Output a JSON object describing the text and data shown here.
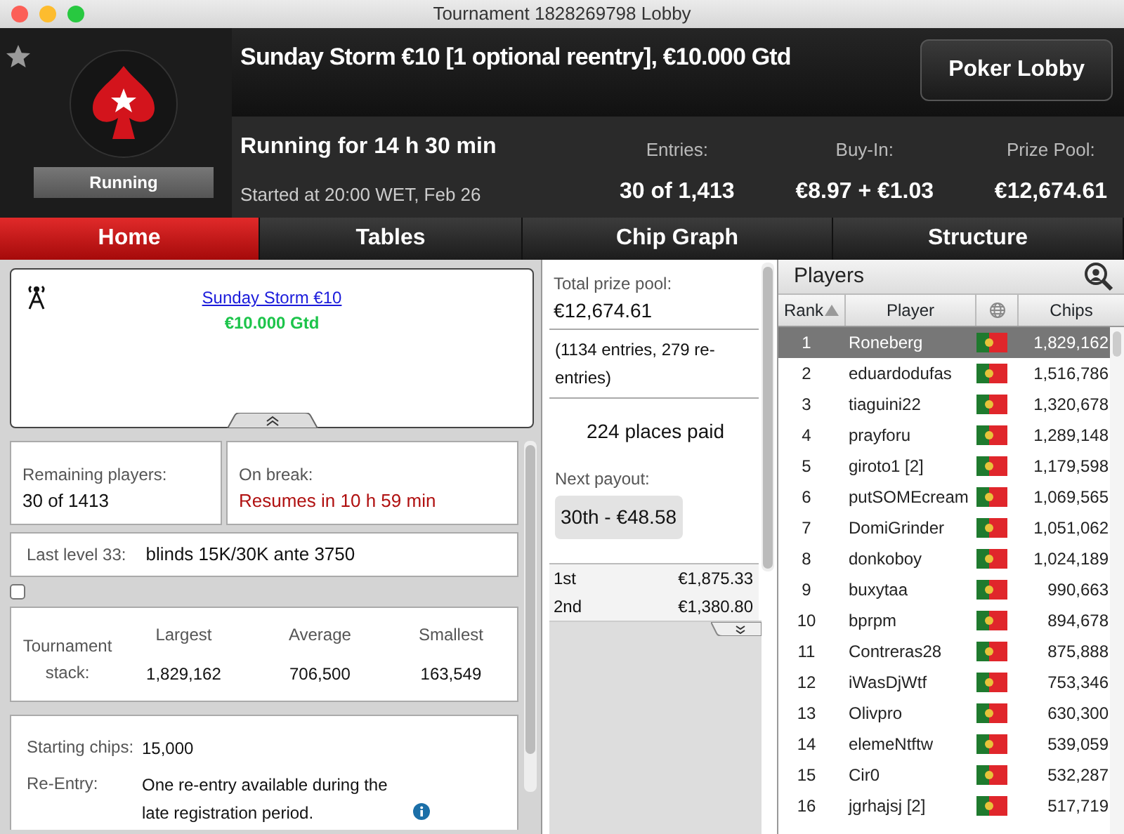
{
  "window": {
    "title": "Tournament 1828269798 Lobby"
  },
  "header": {
    "favorite": false,
    "status": "Running",
    "title": "Sunday Storm €10 [1 optional reentry], €10.000 Gtd",
    "running_for": "Running for 14 h 30 min",
    "started": "Started at 20:00 WET, Feb 26",
    "button": "Poker Lobby",
    "stats": [
      {
        "label": "Entries:",
        "value": "30 of 1,413"
      },
      {
        "label": "Buy-In:",
        "value": "€8.97 + €1.03"
      },
      {
        "label": "Prize Pool:",
        "value": "€12,674.61"
      }
    ]
  },
  "tabs": [
    {
      "label": "Home",
      "selected": true
    },
    {
      "label": "Tables",
      "selected": false
    },
    {
      "label": "Chip Graph",
      "selected": false
    },
    {
      "label": "Structure",
      "selected": false
    }
  ],
  "info": {
    "link": "Sunday Storm €10",
    "guarantee": "€10.000 Gtd"
  },
  "remaining": {
    "label": "Remaining players:",
    "value": "30 of 1413"
  },
  "break": {
    "label": "On break:",
    "value": "Resumes in 10 h 59 min"
  },
  "level": {
    "label": "Last level 33:",
    "value": "blinds 15K/30K ante 3750"
  },
  "option_checkbox": {
    "checked": false
  },
  "stack": {
    "label": "Tournament stack:",
    "columns": [
      {
        "label": "Largest",
        "value": "1,829,162"
      },
      {
        "label": "Average",
        "value": "706,500"
      },
      {
        "label": "Smallest",
        "value": "163,549"
      }
    ]
  },
  "details": [
    {
      "label": "Starting chips:",
      "value": "15,000",
      "info": false
    },
    {
      "label": "Re-Entry:",
      "value": "One re-entry available during the late registration period.",
      "info": true
    }
  ],
  "prizes": {
    "total_label": "Total prize pool:",
    "total": "€12,674.61",
    "entries": "(1134 entries, 279 re-entries)",
    "places": "224 places paid",
    "next_label": "Next payout:",
    "next": "30th - €48.58",
    "payouts": [
      {
        "place": "1st",
        "amount": "€1,875.33"
      },
      {
        "place": "2nd",
        "amount": "€1,380.80"
      }
    ]
  },
  "players": {
    "title": "Players",
    "columns": [
      "Rank",
      "Player",
      "Chips"
    ],
    "rows": [
      {
        "rank": "1",
        "name": "Roneberg",
        "chips": "1,829,162",
        "selected": true
      },
      {
        "rank": "2",
        "name": "eduardodufas",
        "chips": "1,516,786",
        "selected": false
      },
      {
        "rank": "3",
        "name": "tiaguini22",
        "chips": "1,320,678",
        "selected": false
      },
      {
        "rank": "4",
        "name": "prayforu",
        "chips": "1,289,148",
        "selected": false
      },
      {
        "rank": "5",
        "name": "giroto1 [2]",
        "chips": "1,179,598",
        "selected": false
      },
      {
        "rank": "6",
        "name": "putSOMEcream",
        "chips": "1,069,565",
        "selected": false
      },
      {
        "rank": "7",
        "name": "DomiGrinder",
        "chips": "1,051,062",
        "selected": false
      },
      {
        "rank": "8",
        "name": "donkoboy",
        "chips": "1,024,189",
        "selected": false
      },
      {
        "rank": "9",
        "name": "buxytaa",
        "chips": "990,663",
        "selected": false
      },
      {
        "rank": "10",
        "name": "bprpm",
        "chips": "894,678",
        "selected": false
      },
      {
        "rank": "11",
        "name": "Contreras28",
        "chips": "875,888",
        "selected": false
      },
      {
        "rank": "12",
        "name": "iWasDjWtf",
        "chips": "753,346",
        "selected": false
      },
      {
        "rank": "13",
        "name": "Olivpro",
        "chips": "630,300",
        "selected": false
      },
      {
        "rank": "14",
        "name": "elemeNtftw",
        "chips": "539,059",
        "selected": false
      },
      {
        "rank": "15",
        "name": "Cir0",
        "chips": "532,287",
        "selected": false
      },
      {
        "rank": "16",
        "name": "jgrhajsj [2]",
        "chips": "517,719",
        "selected": false
      }
    ]
  }
}
